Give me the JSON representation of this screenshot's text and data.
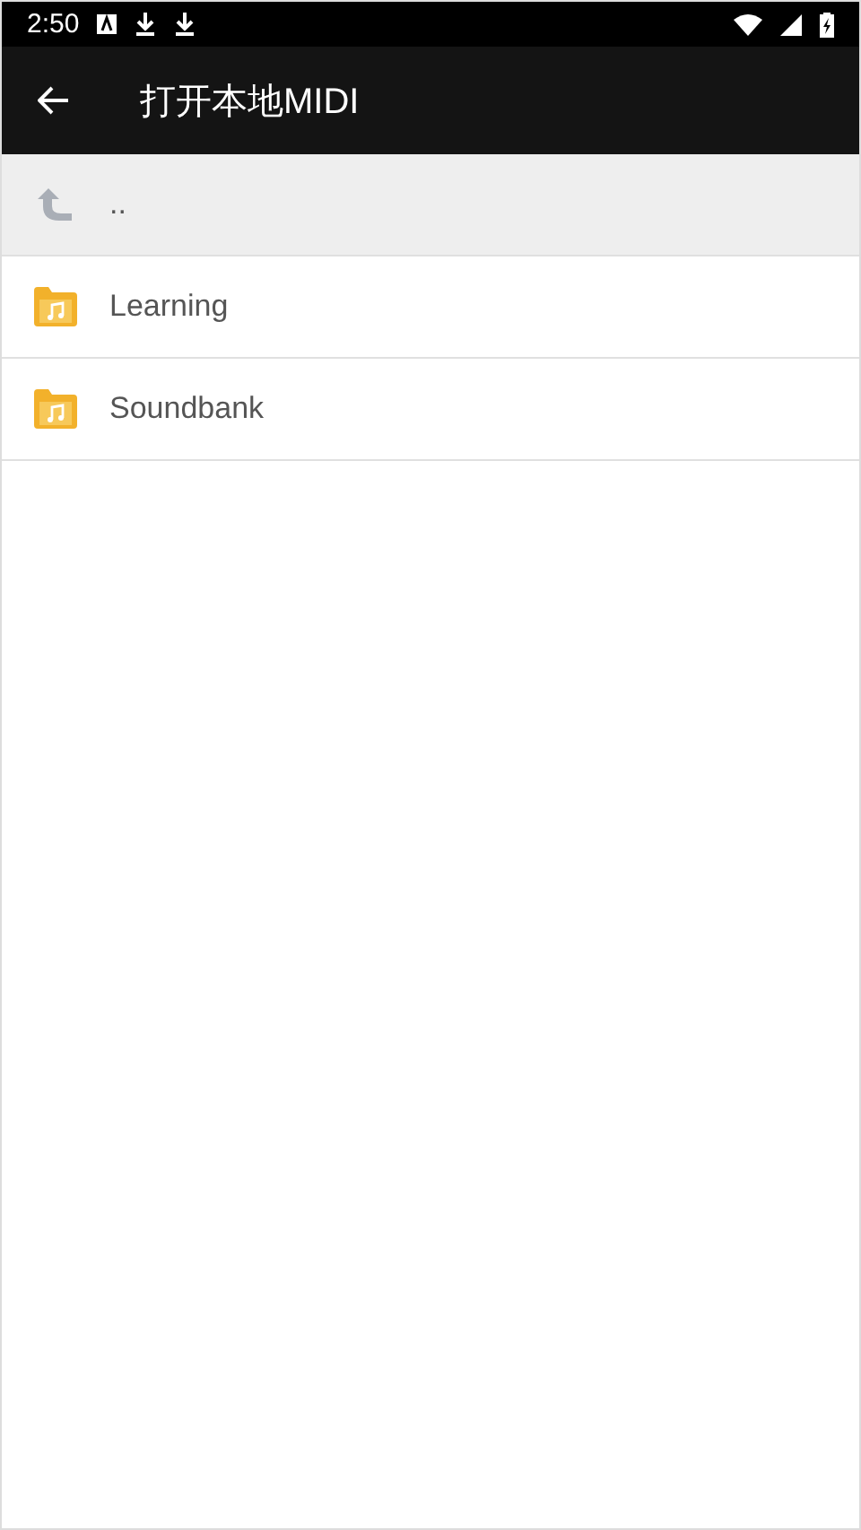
{
  "status_bar": {
    "time": "2:50"
  },
  "toolbar": {
    "title": "打开本地MIDI"
  },
  "entries": [
    {
      "kind": "parent",
      "name": ".."
    },
    {
      "kind": "folder",
      "name": "Learning"
    },
    {
      "kind": "folder",
      "name": "Soundbank"
    }
  ]
}
